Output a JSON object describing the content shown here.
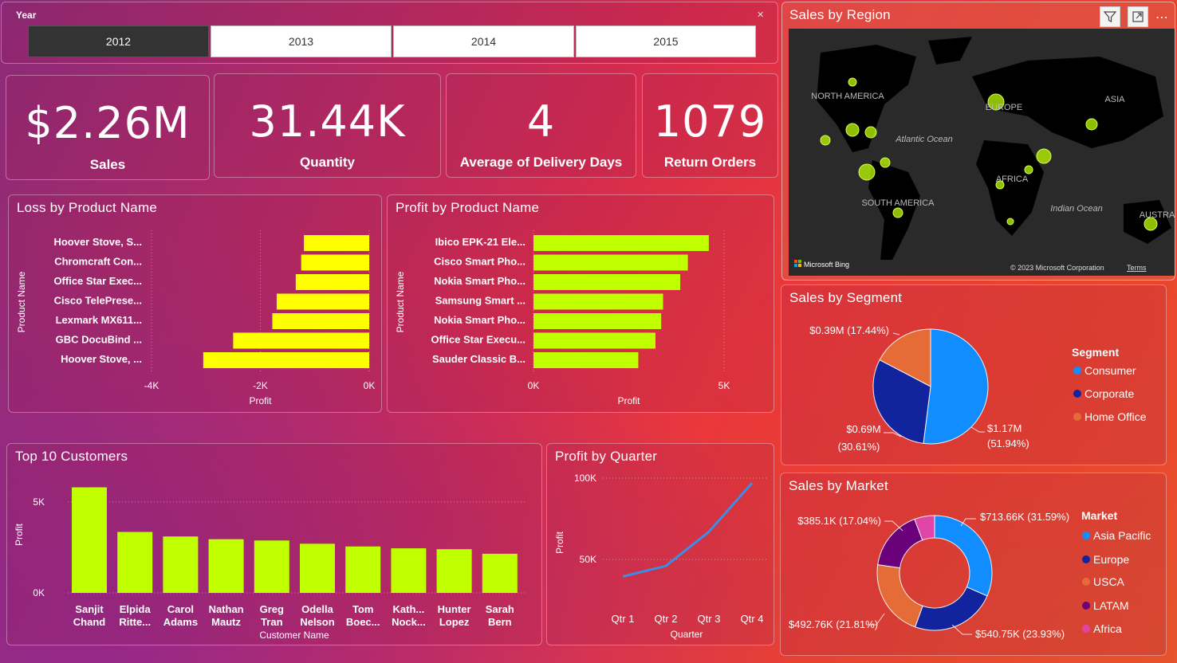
{
  "slicer": {
    "title": "Year",
    "years": [
      "2012",
      "2013",
      "2014",
      "2015"
    ],
    "selected": "2012",
    "clear_icon": "eraser-icon"
  },
  "kpis": [
    {
      "value": "$2.26M",
      "label": "Sales"
    },
    {
      "value": "31.44K",
      "label": "Quantity"
    },
    {
      "value": "4",
      "label": "Average of Delivery Days"
    },
    {
      "value": "1079",
      "label": "Return Orders"
    }
  ],
  "map": {
    "title": "Sales by Region",
    "labels": [
      "NORTH AMERICA",
      "Atlantic Ocean",
      "EUROPE",
      "ASIA",
      "AFRICA",
      "SOUTH AMERICA",
      "Indian Ocean",
      "AUSTRA"
    ],
    "bing": "Microsoft Bing",
    "copyright": "© 2023 Microsoft Corporation",
    "terms": "Terms",
    "icons": [
      "filter-icon",
      "focus-mode-icon",
      "more-options-icon"
    ]
  },
  "colors": {
    "lime": "#bfff00",
    "yellow": "#ffff00",
    "consumer": "#118dff",
    "corporate": "#12239e",
    "home_office": "#e66c37",
    "latam": "#6b007b",
    "africa": "#e044a7"
  },
  "chart_data": [
    {
      "type": "bar",
      "title": "Loss by Product Name",
      "orientation": "horizontal",
      "xlabel": "Profit",
      "ylabel": "Product Name",
      "categories": [
        "Hoover Stove, S...",
        "Chromcraft Con...",
        "Office Star Exec...",
        "Cisco TelePrese...",
        "Lexmark MX611...",
        "GBC DocuBind ...",
        "Hoover Stove, ..."
      ],
      "values": [
        -1200,
        -1250,
        -1350,
        -1700,
        -1780,
        -2500,
        -3050
      ],
      "xlim": [
        -4000,
        0
      ],
      "xticks": [
        "-4K",
        "-2K",
        "0K"
      ],
      "color": "#ffff00"
    },
    {
      "type": "bar",
      "title": "Profit by Product Name",
      "orientation": "horizontal",
      "xlabel": "Profit",
      "ylabel": "Product Name",
      "categories": [
        "Ibico EPK-21 Ele...",
        "Cisco Smart Pho...",
        "Nokia Smart Pho...",
        "Samsung Smart ...",
        "Nokia Smart Pho...",
        "Office Star Execu...",
        "Sauder Classic B..."
      ],
      "values": [
        4600,
        4050,
        3850,
        3400,
        3350,
        3200,
        2750
      ],
      "xlim": [
        0,
        5000
      ],
      "xticks": [
        "0K",
        "5K"
      ],
      "color": "#bfff00"
    },
    {
      "type": "bar",
      "title": "Top 10 Customers",
      "xlabel": "Customer Name",
      "ylabel": "Profit",
      "categories": [
        [
          "Sanjit",
          "Chand"
        ],
        [
          "Elpida",
          "Ritte..."
        ],
        [
          "Carol",
          "Adams"
        ],
        [
          "Nathan",
          "Mautz"
        ],
        [
          "Greg",
          "Tran"
        ],
        [
          "Odella",
          "Nelson"
        ],
        [
          "Tom",
          "Boec..."
        ],
        [
          "Kath...",
          "Nock..."
        ],
        [
          "Hunter",
          "Lopez"
        ],
        [
          "Sarah",
          "Bern"
        ]
      ],
      "values": [
        5800,
        3350,
        3100,
        2950,
        2880,
        2700,
        2550,
        2450,
        2400,
        2150
      ],
      "ylim": [
        0,
        6000
      ],
      "yticks": [
        "0K",
        "5K"
      ],
      "color": "#bfff00"
    },
    {
      "type": "line",
      "title": "Profit by Quarter",
      "xlabel": "Quarter",
      "ylabel": "Profit",
      "x": [
        "Qtr 1",
        "Qtr 2",
        "Qtr 3",
        "Qtr 4"
      ],
      "values": [
        39500,
        46000,
        67000,
        97000
      ],
      "ylim": [
        30000,
        100000
      ],
      "yticks": [
        "50K",
        "100K"
      ],
      "color": "#3a8ee6"
    },
    {
      "type": "pie",
      "title": "Sales by Segment",
      "legend_title": "Segment",
      "labels": [
        "Consumer",
        "Corporate",
        "Home Office"
      ],
      "values": [
        1.17,
        0.69,
        0.39
      ],
      "percent": [
        51.94,
        30.61,
        17.44
      ],
      "data_labels": [
        "$1.17M",
        "(51.94%)",
        "$0.69M",
        "(30.61%)",
        "$0.39M (17.44%)"
      ],
      "legend": "right"
    },
    {
      "type": "pie",
      "title": "Sales by Market",
      "legend_title": "Market",
      "donut": true,
      "labels": [
        "Asia Pacific",
        "Europe",
        "USCA",
        "LATAM",
        "Africa"
      ],
      "values": [
        713.66,
        540.75,
        492.76,
        385.1,
        127.9
      ],
      "percent": [
        31.59,
        23.93,
        21.81,
        17.04,
        5.63
      ],
      "data_labels": [
        "$713.66K (31.59%)",
        "$540.75K (23.93%)",
        "$492.76K (21.81%)",
        "$385.1K (17.04%)"
      ],
      "legend": "right"
    }
  ]
}
